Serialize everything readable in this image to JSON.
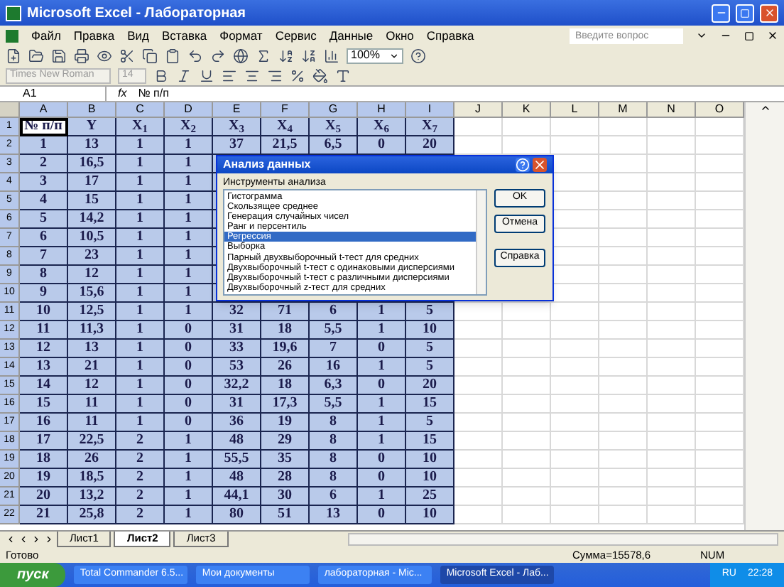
{
  "window": {
    "title": "Microsoft Excel - Лабораторная"
  },
  "menu": [
    "Файл",
    "Правка",
    "Вид",
    "Вставка",
    "Формат",
    "Сервис",
    "Данные",
    "Окно",
    "Справка"
  ],
  "help_search": {
    "placeholder": "Введите вопрос"
  },
  "toolbar": {
    "zoom": "100%"
  },
  "format_toolbar": {
    "font": "Times New Roman",
    "size": "14",
    "disabled": true
  },
  "formula_bar": {
    "name_box": "A1",
    "fx": "fx",
    "formula": "№ п/п"
  },
  "columns": [
    {
      "label": "A",
      "selected": true
    },
    {
      "label": "B",
      "selected": true
    },
    {
      "label": "C",
      "selected": true
    },
    {
      "label": "D",
      "selected": true
    },
    {
      "label": "E",
      "selected": true
    },
    {
      "label": "F",
      "selected": true
    },
    {
      "label": "G",
      "selected": true
    },
    {
      "label": "H",
      "selected": true
    },
    {
      "label": "I",
      "selected": true
    },
    {
      "label": "J",
      "selected": false
    },
    {
      "label": "K",
      "selected": false
    },
    {
      "label": "L",
      "selected": false
    },
    {
      "label": "M",
      "selected": false
    },
    {
      "label": "N",
      "selected": false
    },
    {
      "label": "O",
      "selected": false
    }
  ],
  "rows": [
    {
      "header": "1",
      "cells": [
        {
          "text": "№ п/п",
          "active": true
        },
        {
          "text": "Y",
          "active": false
        },
        {
          "text": "X$_{1}$",
          "active": false
        },
        {
          "text": "X$_{2}$",
          "active": false
        },
        {
          "text": "X$_{3}$",
          "active": false
        },
        {
          "text": "X$_{4}$",
          "active": false
        },
        {
          "text": "X$_{5}$",
          "active": false
        },
        {
          "text": "X$_{6}$",
          "active": false
        },
        {
          "text": "X$_{7}$",
          "active": false
        }
      ]
    },
    {
      "header": "2",
      "cells": [
        "1",
        "13",
        "1",
        "1",
        "37",
        "21,5",
        "6,5",
        "0",
        "20"
      ]
    },
    {
      "header": "3",
      "cells": [
        "2",
        "16,5",
        "1",
        "1",
        null,
        null,
        null,
        null,
        null
      ]
    },
    {
      "header": "4",
      "cells": [
        "3",
        "17",
        "1",
        "1",
        null,
        null,
        null,
        null,
        null
      ]
    },
    {
      "header": "5",
      "cells": [
        "4",
        "15",
        "1",
        "1",
        null,
        null,
        null,
        null,
        null
      ]
    },
    {
      "header": "6",
      "cells": [
        "5",
        "14,2",
        "1",
        "1",
        null,
        null,
        null,
        null,
        null
      ]
    },
    {
      "header": "7",
      "cells": [
        "6",
        "10,5",
        "1",
        "1",
        null,
        null,
        null,
        null,
        null
      ]
    },
    {
      "header": "8",
      "cells": [
        "7",
        "23",
        "1",
        "1",
        null,
        null,
        null,
        null,
        null
      ]
    },
    {
      "header": "9",
      "cells": [
        "8",
        "12",
        "1",
        "1",
        null,
        null,
        null,
        null,
        null
      ]
    },
    {
      "header": "10",
      "cells": [
        "9",
        "15,6",
        "1",
        "1",
        null,
        null,
        null,
        null,
        null
      ]
    },
    {
      "header": "11",
      "cells": [
        "10",
        "12,5",
        "1",
        "1",
        "32",
        "71",
        "6",
        "1",
        "5"
      ]
    },
    {
      "header": "12",
      "cells": [
        "11",
        "11,3",
        "1",
        "0",
        "31",
        "18",
        "5,5",
        "1",
        "10"
      ]
    },
    {
      "header": "13",
      "cells": [
        "12",
        "13",
        "1",
        "0",
        "33",
        "19,6",
        "7",
        "0",
        "5"
      ]
    },
    {
      "header": "14",
      "cells": [
        "13",
        "21",
        "1",
        "0",
        "53",
        "26",
        "16",
        "1",
        "5"
      ]
    },
    {
      "header": "15",
      "cells": [
        "14",
        "12",
        "1",
        "0",
        "32,2",
        "18",
        "6,3",
        "0",
        "20"
      ]
    },
    {
      "header": "16",
      "cells": [
        "15",
        "11",
        "1",
        "0",
        "31",
        "17,3",
        "5,5",
        "1",
        "15"
      ]
    },
    {
      "header": "17",
      "cells": [
        "16",
        "11",
        "1",
        "0",
        "36",
        "19",
        "8",
        "1",
        "5"
      ]
    },
    {
      "header": "18",
      "cells": [
        "17",
        "22,5",
        "2",
        "1",
        "48",
        "29",
        "8",
        "1",
        "15"
      ]
    },
    {
      "header": "19",
      "cells": [
        "18",
        "26",
        "2",
        "1",
        "55,5",
        "35",
        "8",
        "0",
        "10"
      ]
    },
    {
      "header": "20",
      "cells": [
        "19",
        "18,5",
        "2",
        "1",
        "48",
        "28",
        "8",
        "0",
        "10"
      ]
    },
    {
      "header": "21",
      "cells": [
        "20",
        "13,2",
        "2",
        "1",
        "44,1",
        "30",
        "6",
        "1",
        "25"
      ]
    },
    {
      "header": "22",
      "cells": [
        "21",
        "25,8",
        "2",
        "1",
        "80",
        "51",
        "13",
        "0",
        "10"
      ]
    }
  ],
  "dialog": {
    "title": "Анализ данных",
    "label": "Инструменты анализа",
    "items": [
      {
        "text": "Гистограмма",
        "selected": false
      },
      {
        "text": "Скользящее среднее",
        "selected": false
      },
      {
        "text": "Генерация случайных чисел",
        "selected": false
      },
      {
        "text": "Ранг и персентиль",
        "selected": false
      },
      {
        "text": "Регрессия",
        "selected": true
      },
      {
        "text": "Выборка",
        "selected": false
      },
      {
        "text": "Парный двухвыборочный t-тест для средних",
        "selected": false
      },
      {
        "text": "Двухвыборочный t-тест с одинаковыми дисперсиями",
        "selected": false
      },
      {
        "text": "Двухвыборочный t-тест с различными дисперсиями",
        "selected": false
      },
      {
        "text": "Двухвыборочный z-тест для средних",
        "selected": false
      }
    ],
    "buttons": [
      "OK",
      "Отмена",
      "Справка"
    ]
  },
  "sheet_tabs": [
    {
      "label": "Лист1",
      "selected": false
    },
    {
      "label": "Лист2",
      "selected": true
    },
    {
      "label": "Лист3",
      "selected": false
    }
  ],
  "status_bar": {
    "state": "Готово",
    "sum": "Сумма=15578,6",
    "num": "NUM"
  },
  "taskbar": {
    "start": "пуск",
    "tasks": [
      {
        "label": "Total Commander 6.5...",
        "selected": false
      },
      {
        "label": "Мои документы",
        "selected": false
      },
      {
        "label": "лабораторная - Mic...",
        "selected": false
      },
      {
        "label": "Microsoft Excel - Лаб...",
        "selected": true
      }
    ],
    "lang": "RU",
    "time": "22:28"
  }
}
